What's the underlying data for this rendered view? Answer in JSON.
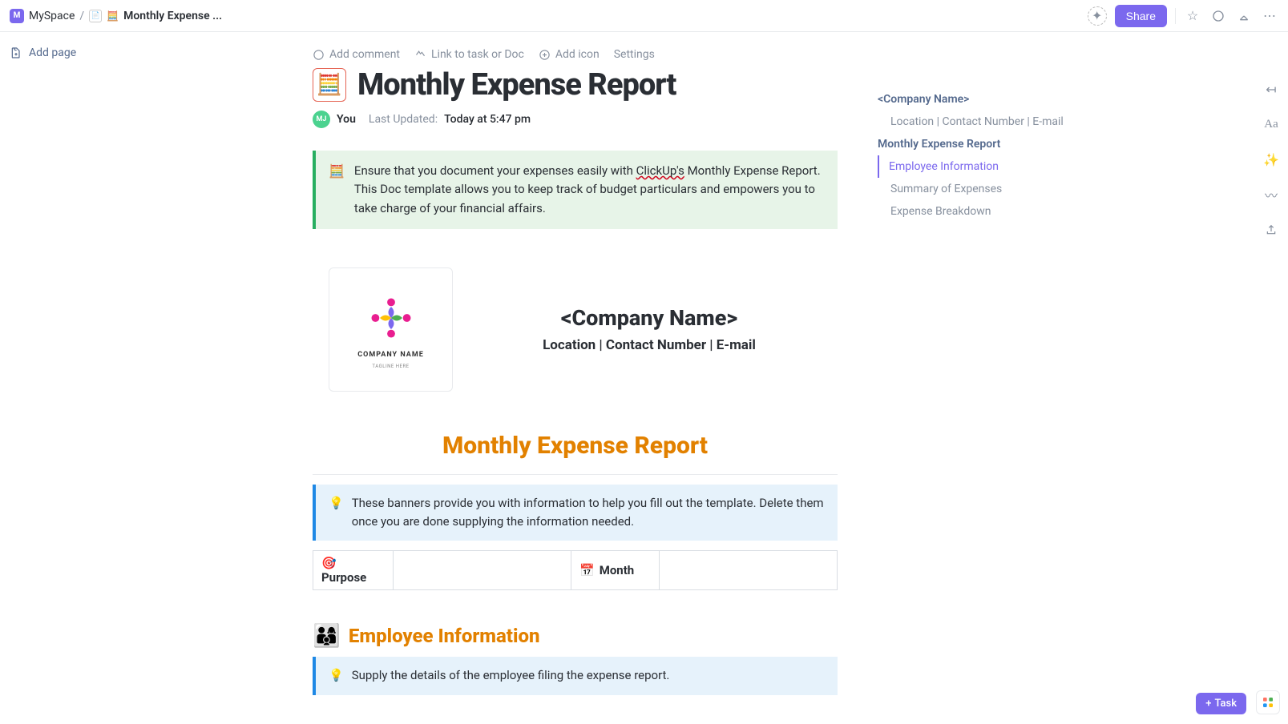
{
  "breadcrumb": {
    "workspace": "M",
    "workspace_name": "MySpace",
    "title": "Monthly Expense ..."
  },
  "topbar": {
    "share": "Share"
  },
  "sidebar": {
    "add_page": "Add page"
  },
  "actions": {
    "comment": "Add comment",
    "link": "Link to task or Doc",
    "icon": "Add icon",
    "settings": "Settings"
  },
  "doc": {
    "title": "Monthly Expense Report",
    "author": "You",
    "author_initials": "MJ",
    "updated_label": "Last Updated:",
    "updated_time": "Today at 5:47 pm"
  },
  "green_banner": {
    "pre": "Ensure that you document your expenses easily with ",
    "link": "ClickUp's",
    "post": " Monthly Expense Report. This Doc template allows you to keep track of budget particulars and empowers you to take charge of your financial affairs."
  },
  "company": {
    "logo_txt": "COMPANY NAME",
    "logo_tag": "TAGLINE HERE",
    "name": "<Company Name>",
    "sub": "Location | Contact Number | E-mail"
  },
  "orange_title": "Monthly Expense Report",
  "tip_banner": "These banners provide you with information to help you fill out the template. Delete them once you are done supplying the information needed.",
  "table": {
    "purpose": "Purpose",
    "month": "Month"
  },
  "section_emp": "Employee Information",
  "emp_tip": "Supply the details of the employee filing the expense report.",
  "outline": [
    {
      "label": "<Company Name>",
      "cls": "a"
    },
    {
      "label": "Location | Contact Number | E-mail",
      "cls": "indent"
    },
    {
      "label": "Monthly Expense Report",
      "cls": "a"
    },
    {
      "label": "Employee Information",
      "cls": "indent active"
    },
    {
      "label": "Summary of Expenses",
      "cls": "indent"
    },
    {
      "label": "Expense Breakdown",
      "cls": "indent"
    }
  ],
  "task_btn": "Task"
}
